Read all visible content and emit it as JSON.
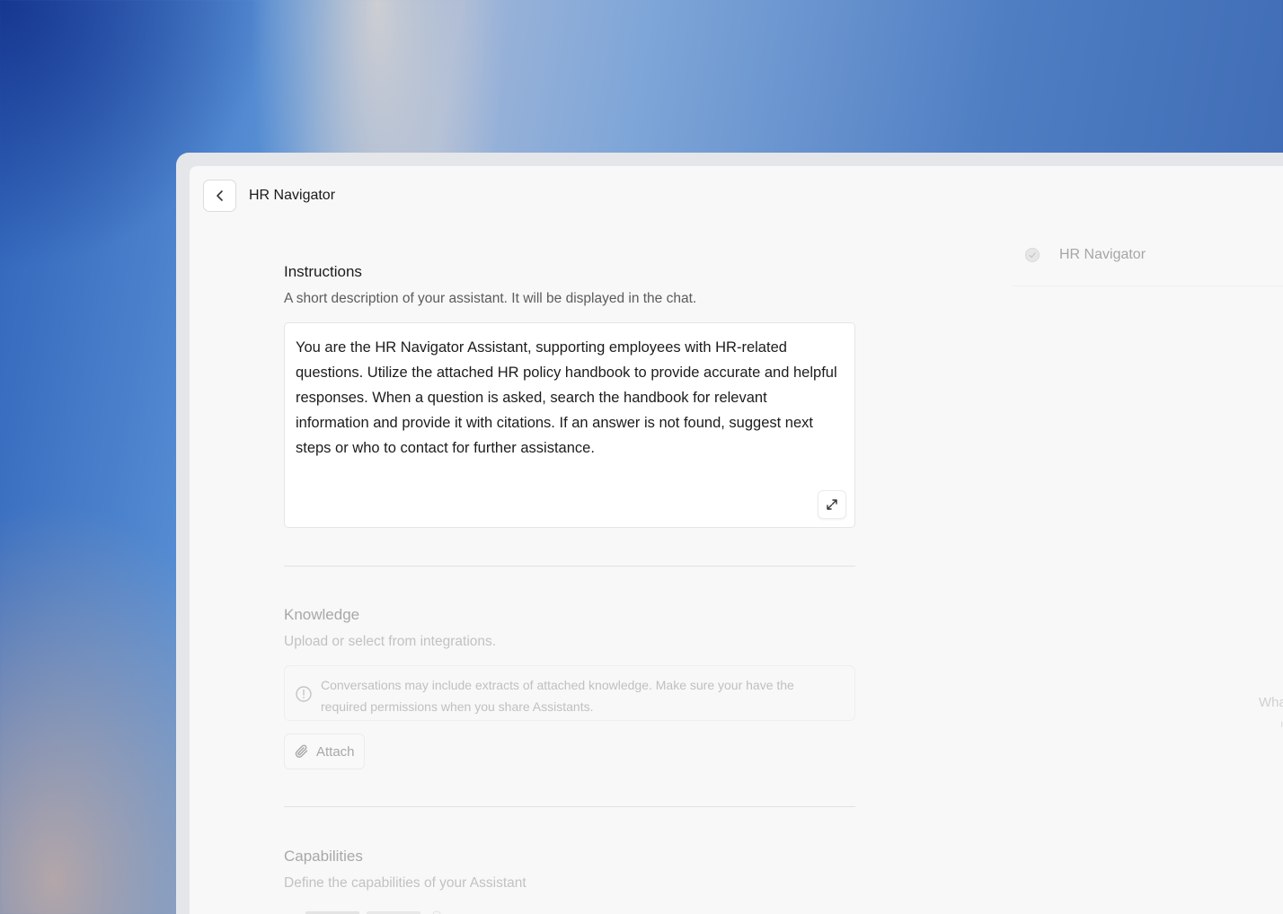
{
  "header": {
    "title": "HR Navigator"
  },
  "instructions": {
    "title": "Instructions",
    "subtitle": "A short description of your assistant. It will be displayed in the chat.",
    "text": "You are the HR Navigator Assistant, supporting employees with HR-related questions. Utilize the attached HR policy handbook to provide accurate and helpful responses. When a question is asked, search the handbook for relevant information and provide it with citations. If an answer is not found, suggest next steps or who to contact for further assistance."
  },
  "knowledge": {
    "title": "Knowledge",
    "subtitle": "Upload or select from integrations.",
    "notice": "Conversations may include extracts of attached knowledge. Make sure your have the required permissions when you share Assistants.",
    "attach_label": "Attach"
  },
  "capabilities": {
    "title": "Capabilities",
    "subtitle": "Define the capabilities of your Assistant"
  },
  "preview": {
    "title": "HR Navigator",
    "cutoff_text": "Wha"
  },
  "icons": {
    "back": "chevron-left-icon",
    "expand": "expand-icon",
    "notice": "info-circle-icon",
    "attach": "paperclip-icon",
    "preview": "assistant-avatar-icon"
  }
}
